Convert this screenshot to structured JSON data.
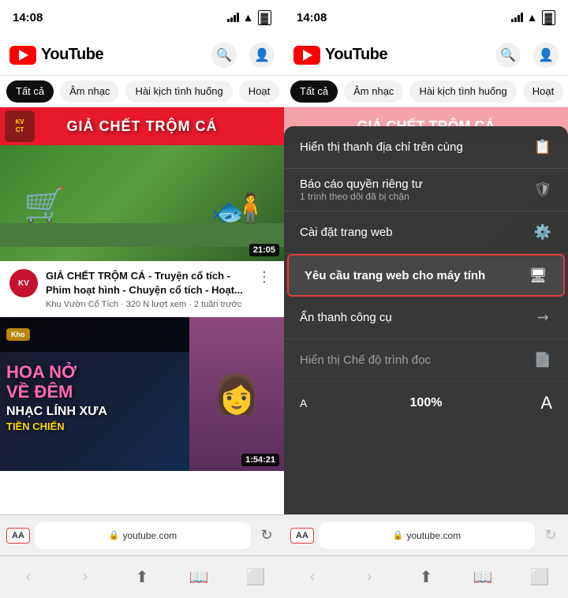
{
  "leftPanel": {
    "statusBar": {
      "time": "14:08"
    },
    "header": {
      "logoText": "YouTube",
      "searchLabel": "search",
      "profileLabel": "profile"
    },
    "categories": [
      "Tất cả",
      "Âm nhạc",
      "Hài kịch tình huống",
      "Hoạt"
    ],
    "video1": {
      "bannerText": "GIẢ CHẾT TRỘM CÁ",
      "channelLogoText": "KV\nCT",
      "title": "GIẢ CHẾT TRỘM CÁ - Truyện cổ tích - Phim hoạt hình - Chuyện cổ tích - Hoạt...",
      "meta": "Khu Vườn Cổ Tích · 320 N lượt xem · 2 tuần trước",
      "duration": "21:05"
    },
    "video2": {
      "khoLabel": "Kho",
      "mainTitle": "HOA NỞ\nVỀ ĐÊM",
      "subTitle": "NHẠC LÍNH XƯA",
      "artistName": "TIỀN CHIẾN",
      "duration": "1:54:21"
    },
    "browserBar": {
      "aaLabel": "AA",
      "urlText": "youtube.com"
    }
  },
  "rightPanel": {
    "statusBar": {
      "time": "14:08"
    },
    "header": {
      "logoText": "YouTube"
    },
    "contextMenu": {
      "items": [
        {
          "text": "Hiển thị thanh địa chỉ trên cùng",
          "icon": "📋",
          "subtext": ""
        },
        {
          "text": "Báo cáo quyền riêng tư",
          "subtext": "1 trình theo dõi đã bị chặn",
          "icon": "🛡"
        },
        {
          "text": "Cài đặt trang web",
          "icon": "⚙️",
          "subtext": ""
        },
        {
          "text": "Yêu cầu trang web cho máy tính",
          "icon": "🖥",
          "subtext": "",
          "highlighted": true
        },
        {
          "text": "Ẩn thanh công cụ",
          "icon": "↗",
          "subtext": ""
        },
        {
          "text": "Hiển thị Chế độ trình đọc",
          "icon": "📄",
          "subtext": "",
          "disabled": true
        },
        {
          "text": "100%",
          "isZoom": true,
          "smallA": "A",
          "largeA": "A"
        }
      ]
    },
    "browserBar": {
      "aaLabel": "AA",
      "urlText": "youtube.com"
    }
  },
  "colors": {
    "accent": "#e23c3c",
    "ytRed": "#ff0000",
    "menuBg": "#323232",
    "chipActive": "#0f0f0f"
  }
}
